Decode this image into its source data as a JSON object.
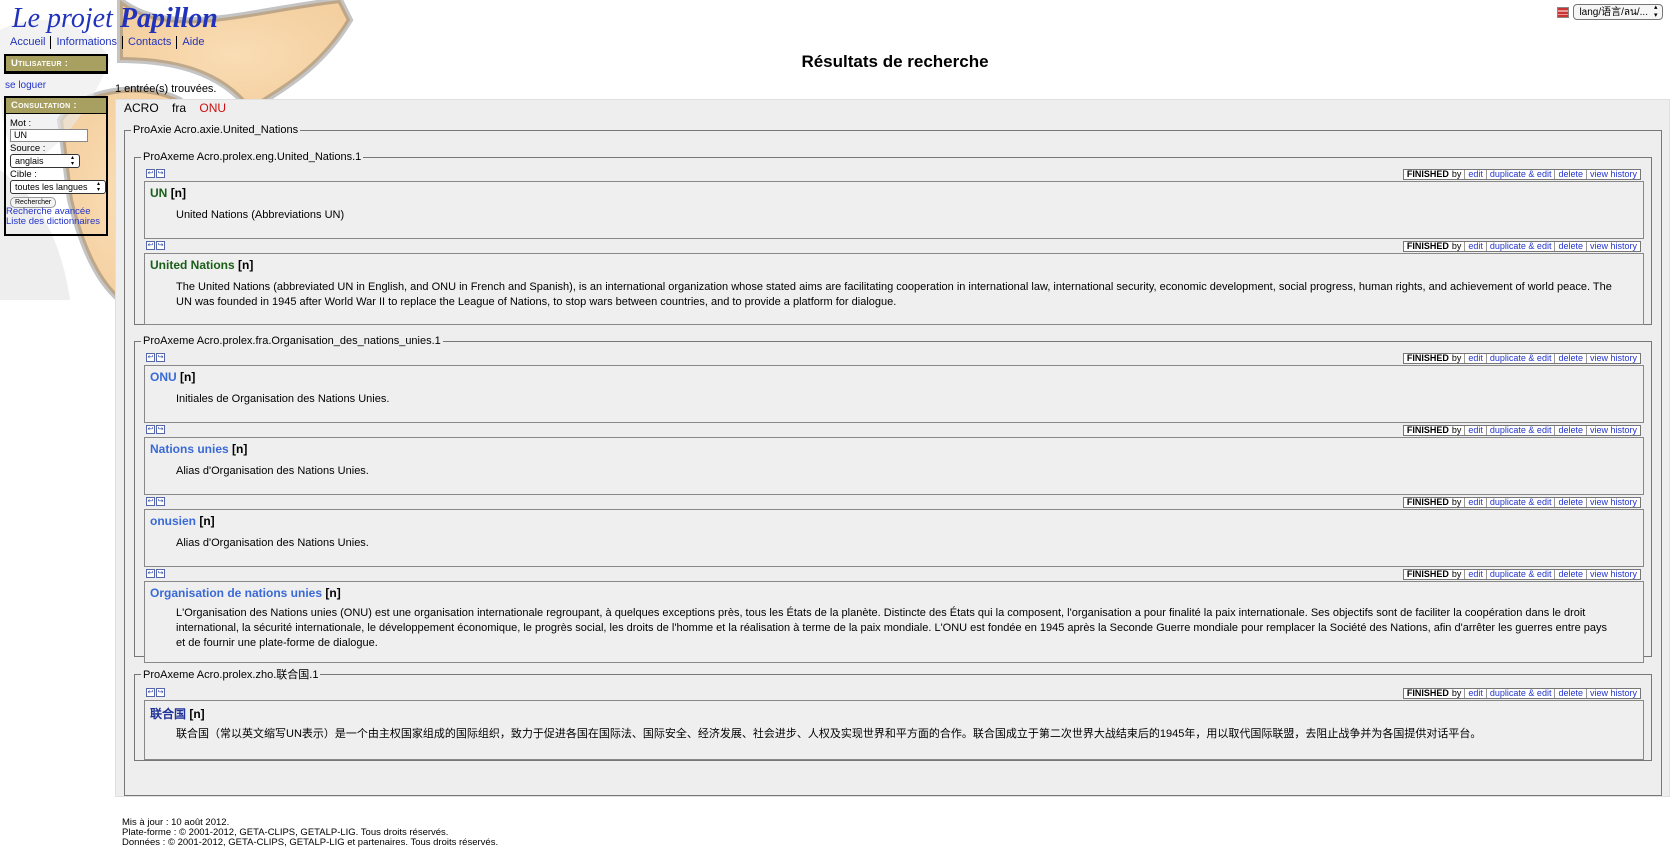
{
  "site": {
    "logo_prefix": "Le projet",
    "logo_name": "Papillon",
    "nav": [
      "Accueil",
      "Informations",
      "Contacts",
      "Aide"
    ],
    "lang_select": "lang/语言/ลน/..."
  },
  "sidebar": {
    "user_header": "Utilisateur :",
    "login_link": "se loguer",
    "consult_header": "Consultation :",
    "mot_label": "Mot :",
    "mot_value": "UN",
    "source_label": "Source :",
    "source_value": "anglais",
    "cible_label": "Cible :",
    "cible_value": "toutes les langues",
    "search_button": "Rechercher",
    "advanced_link": "Recherche avancée",
    "dict_list_link": "Liste des dictionnaires"
  },
  "main": {
    "title": "Résultats de recherche",
    "count": "1 entrée(s) trouvées.",
    "entry": {
      "dict": "ACRO",
      "lang": "fra",
      "word": "ONU"
    },
    "axie_legend": "ProAxie Acro.axie.United_Nations",
    "status_label": "FINISHED",
    "status_by": "by",
    "actions": [
      "edit",
      "duplicate & edit",
      "delete",
      "view history"
    ],
    "axemes": [
      {
        "legend": "ProAxeme Acro.prolex.eng.United_Nations.1",
        "blocks": [
          {
            "word": "UN",
            "pos": "[n]",
            "gloss": "United Nations (Abbreviations UN)"
          },
          {
            "word": "United Nations",
            "pos": "[n]",
            "gloss": "The United Nations (abbreviated UN in English, and ONU in French and Spanish), is an international organization whose stated aims are facilitating cooperation in international law, international security, economic development, social progress, human rights, and achievement of world peace. The UN was founded in 1945 after World War II to replace the League of Nations, to stop wars between countries, and to provide a platform for dialogue."
          }
        ]
      },
      {
        "legend": "ProAxeme Acro.prolex.fra.Organisation_des_nations_unies.1",
        "blocks": [
          {
            "word": "ONU",
            "pos": "[n]",
            "gloss": "Initiales de Organisation des Nations Unies."
          },
          {
            "word": "Nations unies",
            "pos": "[n]",
            "gloss": "Alias d'Organisation des Nations Unies."
          },
          {
            "word": "onusien",
            "pos": "[n]",
            "gloss": "Alias d'Organisation des Nations Unies."
          },
          {
            "word": "Organisation de nations unies",
            "pos": "[n]",
            "gloss": "L'Organisation des Nations unies (ONU) est une organisation internationale regroupant, à quelques exceptions près, tous les États de la planète. Distincte des États qui la composent, l'organisation a pour finalité la paix internationale. Ses objectifs sont de faciliter la coopération dans le droit international, la sécurité internationale, le développement économique, le progrès social, les droits de l'homme et la réalisation à terme de la paix mondiale. L'ONU est fondée en 1945 après la Seconde Guerre mondiale pour remplacer la Société des Nations, afin d'arrêter les guerres entre pays et de fournir une plate-forme de dialogue."
          }
        ]
      },
      {
        "legend": "ProAxeme Acro.prolex.zho.联合国.1",
        "blocks": [
          {
            "word": "联合国",
            "pos": "[n]",
            "gloss": "联合国（常以英文缩写UN表示）是一个由主权国家组成的国际组织，致力于促进各国在国际法、国际安全、经济发展、社会进步、人权及实现世界和平方面的合作。联合国成立于第二次世界大战结束后的1945年，用以取代国际联盟，去阻止战争并为各国提供对话平台。"
          }
        ]
      }
    ]
  },
  "footer": {
    "line1": "Mis à jour : 10 août 2012.",
    "line2": "Plate-forme : © 2001-2012, GETA-CLIPS, GETALP-LIG. Tous droits réservés.",
    "line3": "Données : © 2001-2012, GETA-CLIPS, GETALP-LIG et partenaires. Tous droits réservés."
  }
}
